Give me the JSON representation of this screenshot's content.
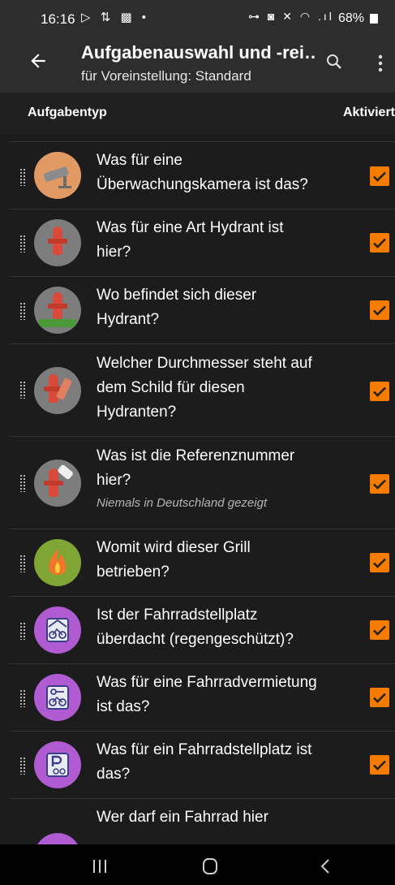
{
  "status_bar": {
    "time": "16:16",
    "left_icons": "▷ ⇅ ▩ •",
    "right_icons": "⊶ ◙ ✕ ◠ .ıl",
    "battery": "68%"
  },
  "app_bar": {
    "title": "Aufgabenauswahl und -rei…",
    "subtitle": "für Voreinstellung: Standard",
    "back_icon": "arrow-left-icon",
    "search_icon": "search-icon",
    "more_icon": "more-vert-icon"
  },
  "column_header": {
    "left": "Aufgabentyp",
    "right": "Aktiviert"
  },
  "colors": {
    "accent": "#f57c00",
    "surface": "#1c1c1c",
    "bar": "#2d2d2d"
  },
  "quests": [
    {
      "line1": "Was für eine",
      "line2": "Überwachungskamera ist das?",
      "line3": "",
      "note": "",
      "icon": "surveillance-camera-icon",
      "checked": true
    },
    {
      "line1": "Was für eine Art Hydrant ist",
      "line2": "hier?",
      "line3": "",
      "note": "",
      "icon": "fire-hydrant-icon",
      "checked": true
    },
    {
      "line1": "Wo befindet sich dieser",
      "line2": "Hydrant?",
      "line3": "",
      "note": "",
      "icon": "fire-hydrant-position-icon",
      "checked": true
    },
    {
      "line1": "Welcher Durchmesser steht auf",
      "line2": "dem Schild für diesen",
      "line3": "Hydranten?",
      "note": "",
      "icon": "fire-hydrant-diameter-icon",
      "checked": true
    },
    {
      "line1": "Was ist die Referenznummer",
      "line2": "hier?",
      "line3": "",
      "note": "Niemals in Deutschland gezeigt",
      "icon": "fire-hydrant-ref-icon",
      "checked": true
    },
    {
      "line1": "Womit wird dieser Grill",
      "line2": "betrieben?",
      "line3": "",
      "note": "",
      "icon": "bbq-fire-icon",
      "checked": true
    },
    {
      "line1": "Ist der Fahrradstellplatz",
      "line2": "überdacht (regengeschützt)?",
      "line3": "",
      "note": "",
      "icon": "bicycle-parking-cover-icon",
      "checked": true
    },
    {
      "line1": "Was für eine Fahrradvermietung",
      "line2": "ist das?",
      "line3": "",
      "note": "",
      "icon": "bicycle-rental-icon",
      "checked": true
    },
    {
      "line1": "Was für ein Fahrradstellplatz ist",
      "line2": "das?",
      "line3": "",
      "note": "",
      "icon": "bicycle-parking-type-icon",
      "checked": true
    },
    {
      "line1": "Wer darf ein Fahrrad hier",
      "line2": "",
      "line3": "",
      "note": "",
      "icon": "bicycle-parking-access-icon",
      "checked": false
    }
  ],
  "nav_bar": {
    "recent": "recent-apps-icon",
    "home": "home-icon",
    "back": "back-icon"
  }
}
